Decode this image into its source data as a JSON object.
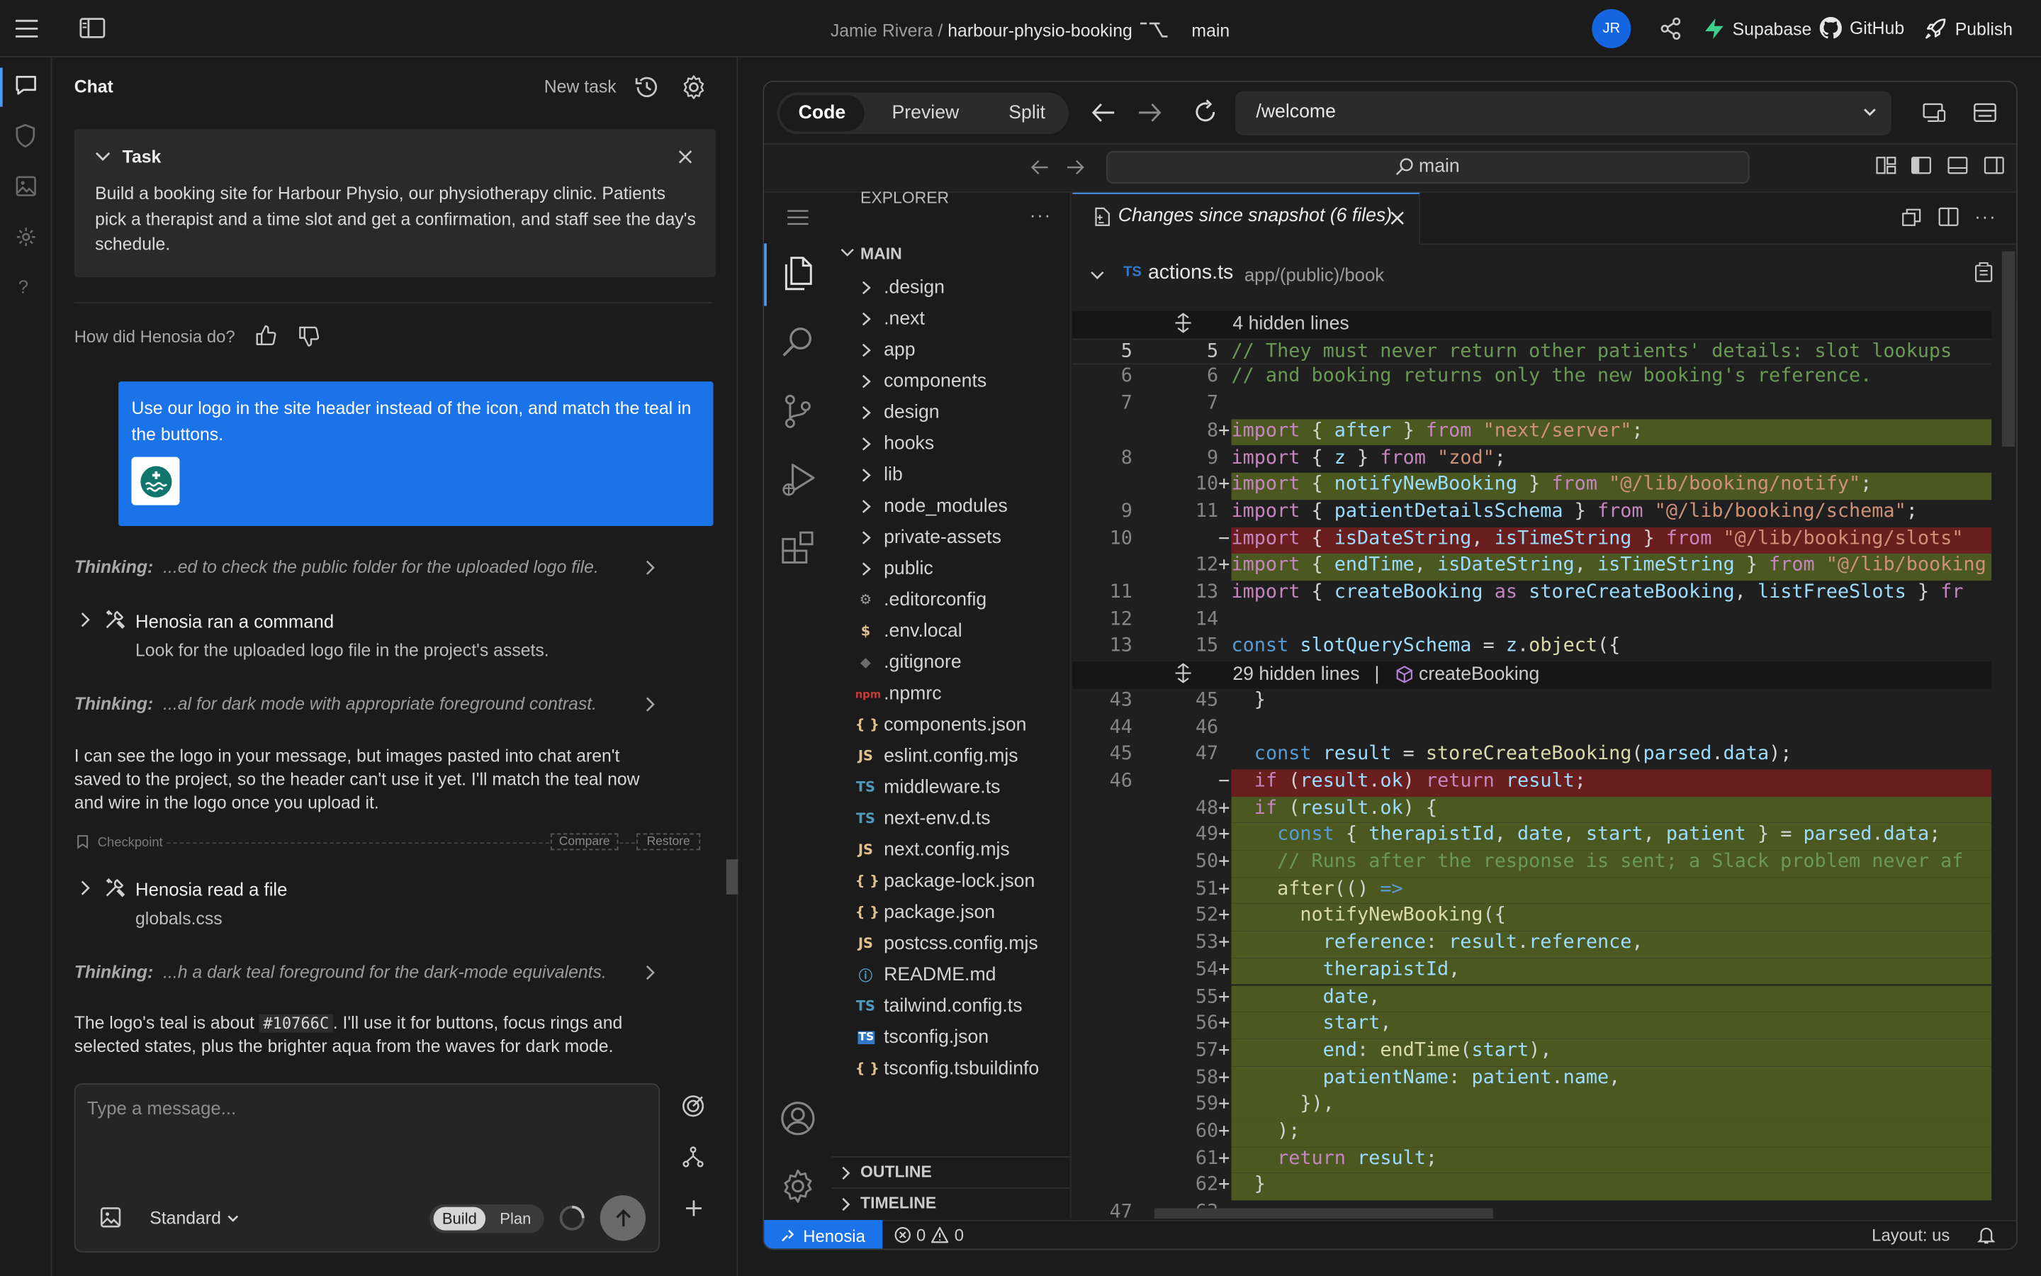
{
  "topbar": {
    "owner": "Jamie Rivera",
    "sep": "/",
    "repo": "harbour-physio-booking",
    "branch": "main",
    "avatar": "JR",
    "supabase": "Supabase",
    "github": "GitHub",
    "publish": "Publish"
  },
  "chat": {
    "title": "Chat",
    "new_task": "New task",
    "task_title": "Task",
    "task_body": "Build a booking site for Harbour Physio, our physiotherapy clinic. Patients pick a therapist and a time slot and get a confirmation, and staff see the day's schedule.",
    "feedback_q": "How did Henosia do?",
    "user_msg": "Use our logo in the site header instead of the icon, and match the teal in the buttons.",
    "thinking_label": "Thinking:",
    "thinking1": "...ed to check the public folder for the uploaded logo file.",
    "tool1_title": "Henosia ran a command",
    "tool1_desc": "Look for the uploaded logo file in the project's assets.",
    "thinking2": "...al for dark mode with appropriate foreground contrast.",
    "reply1": "I can see the logo in your message, but images pasted into chat aren't saved to the project, so the header can't use it yet. I'll match the teal now and wire in the logo once you upload it.",
    "checkpoint": "Checkpoint",
    "compare": "Compare",
    "restore": "Restore",
    "tool2_title": "Henosia read a file",
    "tool2_desc": "globals.css",
    "thinking3": "...h a dark teal foreground for the dark-mode equivalents.",
    "reply2_a": "The logo's teal is about ",
    "reply2_code": "#10766C",
    "reply2_b": ". I'll use it for buttons, focus rings and selected states, plus the brighter aqua from the waves for dark mode.",
    "input_placeholder": "Type a message...",
    "mode": "Standard",
    "build": "Build",
    "plan": "Plan"
  },
  "ide": {
    "tabs": [
      "Code",
      "Preview",
      "Split"
    ],
    "url": "/welcome",
    "search": "main",
    "explorer": "EXPLORER",
    "root": "MAIN",
    "files": [
      {
        "name": ".design",
        "icon": "folder"
      },
      {
        "name": ".next",
        "icon": "folder"
      },
      {
        "name": "app",
        "icon": "folder"
      },
      {
        "name": "components",
        "icon": "folder"
      },
      {
        "name": "design",
        "icon": "folder"
      },
      {
        "name": "hooks",
        "icon": "folder"
      },
      {
        "name": "lib",
        "icon": "folder"
      },
      {
        "name": "node_modules",
        "icon": "folder"
      },
      {
        "name": "private-assets",
        "icon": "folder"
      },
      {
        "name": "public",
        "icon": "folder"
      },
      {
        "name": ".editorconfig",
        "icon": "gear"
      },
      {
        "name": ".env.local",
        "icon": "dollar"
      },
      {
        "name": ".gitignore",
        "icon": "diamond"
      },
      {
        "name": ".npmrc",
        "icon": "npm"
      },
      {
        "name": "components.json",
        "icon": "json"
      },
      {
        "name": "eslint.config.mjs",
        "icon": "js"
      },
      {
        "name": "middleware.ts",
        "icon": "ts"
      },
      {
        "name": "next-env.d.ts",
        "icon": "ts"
      },
      {
        "name": "next.config.mjs",
        "icon": "js"
      },
      {
        "name": "package-lock.json",
        "icon": "json"
      },
      {
        "name": "package.json",
        "icon": "json"
      },
      {
        "name": "postcss.config.mjs",
        "icon": "js"
      },
      {
        "name": "README.md",
        "icon": "info"
      },
      {
        "name": "tailwind.config.ts",
        "icon": "ts"
      },
      {
        "name": "tsconfig.json",
        "icon": "tsbox"
      },
      {
        "name": "tsconfig.tsbuildinfo",
        "icon": "json"
      }
    ],
    "outline": "OUTLINE",
    "timeline": "TIMELINE",
    "editor_tab": "Changes since snapshot (6 files)",
    "file_name": "actions.ts",
    "file_path": "app/(public)/book",
    "hidden1": "4 hidden lines",
    "hidden2": "29 hidden lines",
    "hidden2_sep": "|",
    "hidden2_symbol": "createBooking",
    "status_branch": "Henosia",
    "status_errors": "0",
    "status_warnings": "0",
    "status_layout": "Layout: us"
  }
}
